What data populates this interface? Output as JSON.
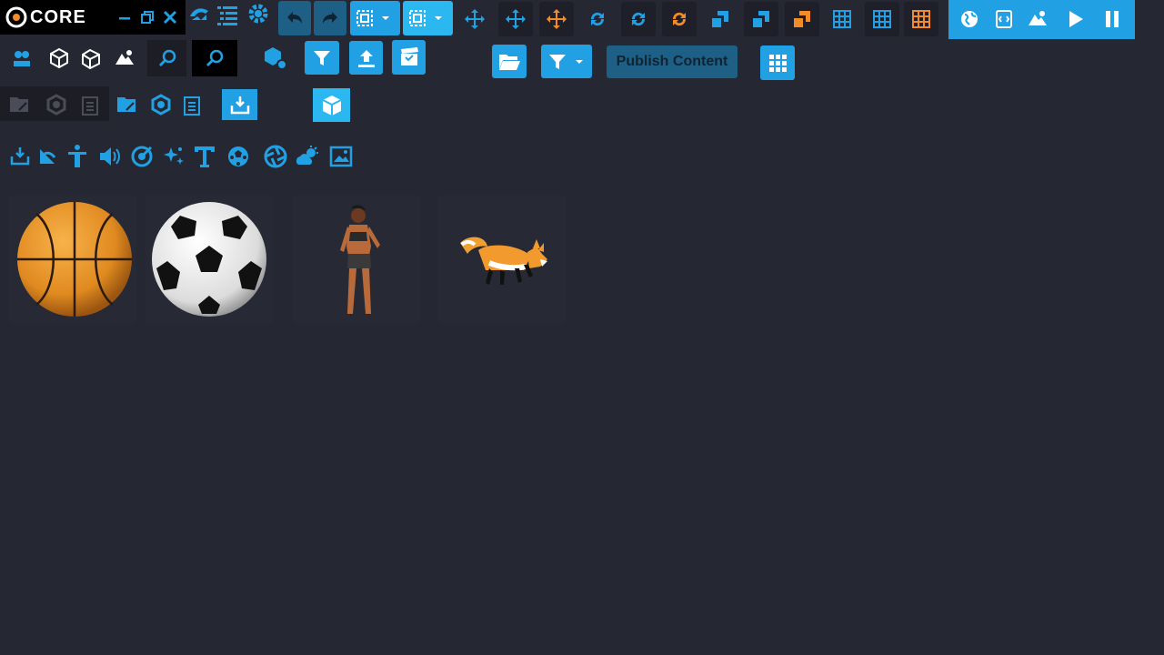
{
  "app": {
    "logo_text": "CORE"
  },
  "colors": {
    "background": "#252733",
    "accent": "#21a1e3",
    "orange": "#f28c28",
    "steel": "#1d5f85"
  },
  "toolbar": {
    "publish_label": "Publish Content"
  },
  "icons": [
    "minimize-icon",
    "restore-icon",
    "close-icon",
    "community-icon",
    "outline-list-icon",
    "settings-gear-icon",
    "undo-icon",
    "redo-icon",
    "select-group-icon",
    "select-object-icon",
    "move-icon",
    "rotate-icon",
    "scale-icon",
    "grid-icon",
    "globe-icon",
    "script-icon",
    "terrain-icon",
    "play-icon",
    "pause-icon",
    "community-content-icon",
    "core-content-icon",
    "kits-icon",
    "templates-icon",
    "search-icon",
    "filter-icon",
    "upload-icon",
    "clapper-icon",
    "folder-open-icon",
    "filter-dropdown-icon",
    "grid-apps-icon",
    "import-icon",
    "cube-icon",
    "animation-icon",
    "humanoid-icon",
    "audio-icon",
    "effects-icon",
    "sparkle-icon",
    "text-icon",
    "ball-icon",
    "aperture-icon",
    "weather-icon",
    "image-icon"
  ],
  "assets": [
    {
      "name": "basketball"
    },
    {
      "name": "soccer ball"
    },
    {
      "name": "character"
    },
    {
      "name": "fox"
    }
  ]
}
